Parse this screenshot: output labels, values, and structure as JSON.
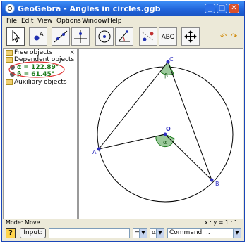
{
  "window": {
    "title": "GeoGebra - Angles in circles.ggb"
  },
  "menu": [
    "File",
    "Edit",
    "View",
    "Options",
    "Window",
    "Help"
  ],
  "toolbar": {
    "text_tool_label": "ABC"
  },
  "algebra_view": {
    "close": "×",
    "free_objects": "Free objects",
    "dependent_objects": "Dependent objects",
    "items": [
      {
        "text": "α = 122.89°"
      },
      {
        "text": "β = 61.45°"
      }
    ],
    "auxiliary_objects": "Auxiliary objects"
  },
  "graphics": {
    "labels": {
      "A": "A",
      "B": "B",
      "C": "C",
      "O": "O",
      "alpha": "α",
      "beta": "β"
    }
  },
  "status": {
    "mode": "Mode: Move",
    "coords": "x : y = 1 : 1"
  },
  "input_bar": {
    "help_label": "?",
    "input_label": "Input:",
    "equals_select": "=",
    "symbol_select": "α",
    "command_select": "Command ..."
  },
  "colors": {
    "title_bar": "#2a6ee6",
    "highlight": "#e03030",
    "angle_fill": "#1a7a1a",
    "point": "#3030c0"
  }
}
